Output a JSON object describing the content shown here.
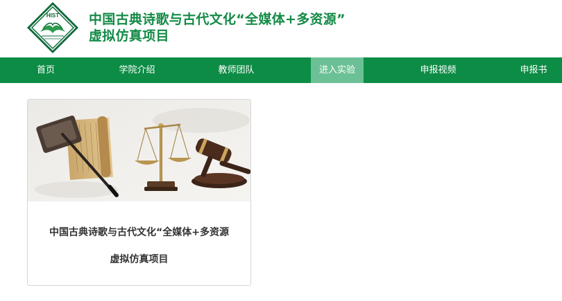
{
  "header": {
    "logo_text": "HIST",
    "title_line1": "中国古典诗歌与古代文化“全媒体+多资源”",
    "title_line2": "虚拟仿真项目"
  },
  "nav": {
    "items": [
      {
        "label": "首页"
      },
      {
        "label": "学院介绍"
      },
      {
        "label": "教师团队"
      },
      {
        "label": "进入实验"
      },
      {
        "label": "申报视频"
      },
      {
        "label": "申报书"
      }
    ],
    "active_index": 3
  },
  "card": {
    "title_line1": "中国古典诗歌与古代文化“全媒体+多资源",
    "title_line2": "虚拟仿真项目"
  },
  "colors": {
    "brand_green": "#0d8c45",
    "title_green": "#138a46",
    "nav_active": "#6cc096"
  }
}
